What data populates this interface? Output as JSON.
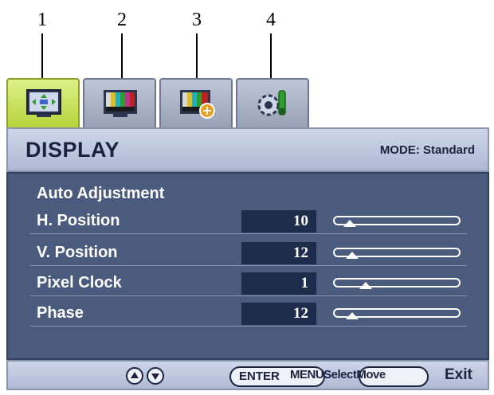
{
  "callouts": [
    "1",
    "2",
    "3",
    "4"
  ],
  "tabs": [
    {
      "icon": "display-arrows-icon",
      "active": true
    },
    {
      "icon": "color-bars-icon",
      "active": false
    },
    {
      "icon": "color-bars-plus-icon",
      "active": false
    },
    {
      "icon": "gear-wrench-icon",
      "active": false
    }
  ],
  "header": {
    "title": "DISPLAY",
    "mode": "MODE: Standard"
  },
  "menu": {
    "auto_adjust": "Auto Adjustment",
    "items": [
      {
        "label": "H. Position",
        "value": "10",
        "level": 0.12
      },
      {
        "label": "V. Position",
        "value": "12",
        "level": 0.14
      },
      {
        "label": "Pixel Clock",
        "value": "1",
        "level": 0.25
      },
      {
        "label": "Phase",
        "value": "12",
        "level": 0.14
      }
    ]
  },
  "footer": {
    "up_down_icon": "up-down-arrows-icon",
    "enter": "ENTER",
    "overlap": "MENUSelectMove",
    "exit": "Exit"
  }
}
